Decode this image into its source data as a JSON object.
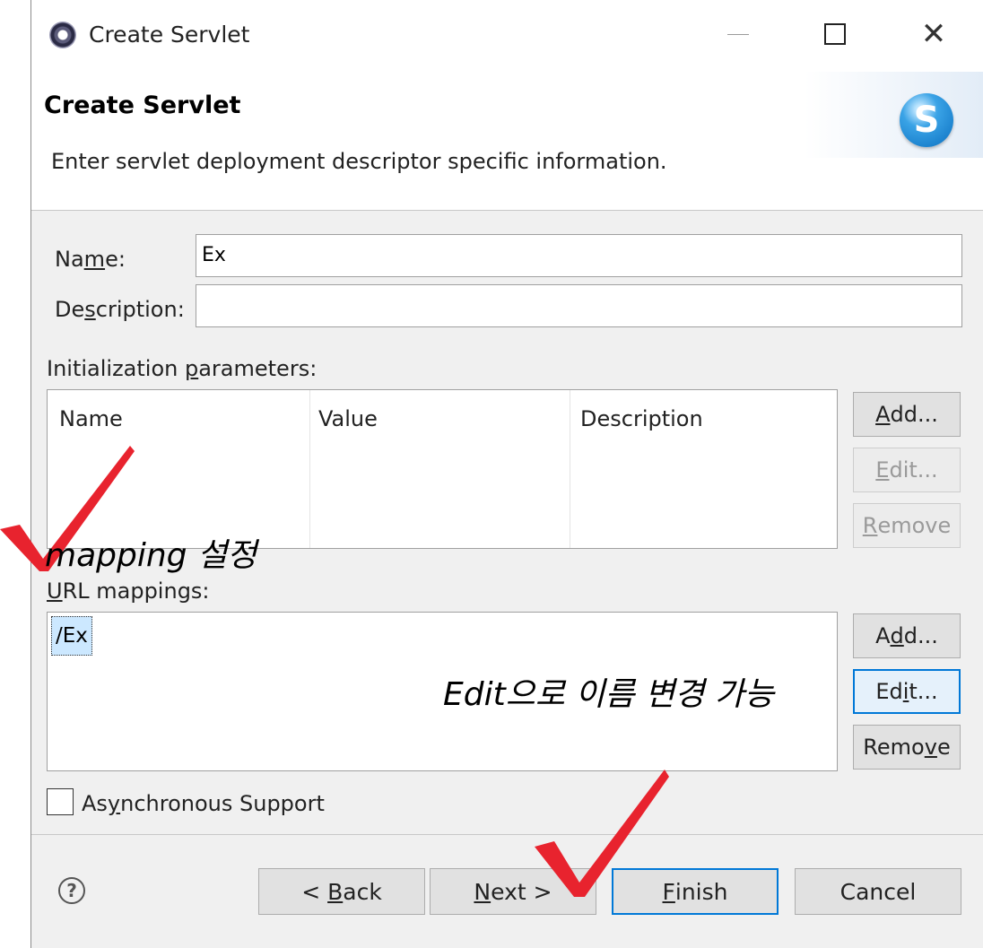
{
  "window": {
    "title": "Create Servlet"
  },
  "banner": {
    "title": "Create Servlet",
    "description": "Enter servlet deployment descriptor specific information.",
    "logo_letter": "S"
  },
  "form": {
    "name_label_pre": "Na",
    "name_label_u": "m",
    "name_label_post": "e:",
    "name_value": "Ex",
    "desc_label_pre": "De",
    "desc_label_u": "s",
    "desc_label_post": "cription:",
    "desc_value": ""
  },
  "init_params": {
    "label_pre": "Initialization ",
    "label_u": "p",
    "label_post": "arameters:",
    "columns": [
      "Name",
      "Value",
      "Description"
    ],
    "buttons": {
      "add_u": "A",
      "add_rest": "dd...",
      "edit_u": "E",
      "edit_rest": "dit...",
      "remove_u": "R",
      "remove_rest": "emove"
    }
  },
  "url_mappings": {
    "label_u": "U",
    "label_rest": "RL mappings:",
    "items": [
      "/Ex"
    ],
    "buttons": {
      "add_pre": "A",
      "add_u": "d",
      "add_post": "d...",
      "edit_pre": "Ed",
      "edit_u": "i",
      "edit_post": "t...",
      "remove_pre": "Remo",
      "remove_u": "v",
      "remove_post": "e"
    }
  },
  "async": {
    "pre": "As",
    "u": "y",
    "post": "nchronous Support",
    "checked": false
  },
  "footer": {
    "back_pre": "< ",
    "back_u": "B",
    "back_post": "ack",
    "next_u": "N",
    "next_post": "ext >",
    "finish_u": "F",
    "finish_post": "inish",
    "cancel": "Cancel"
  },
  "annotations": {
    "mapping_note": "mapping 설정",
    "edit_note": "Edit으로 이름 변경 가능",
    "check_color": "#e8232e"
  }
}
